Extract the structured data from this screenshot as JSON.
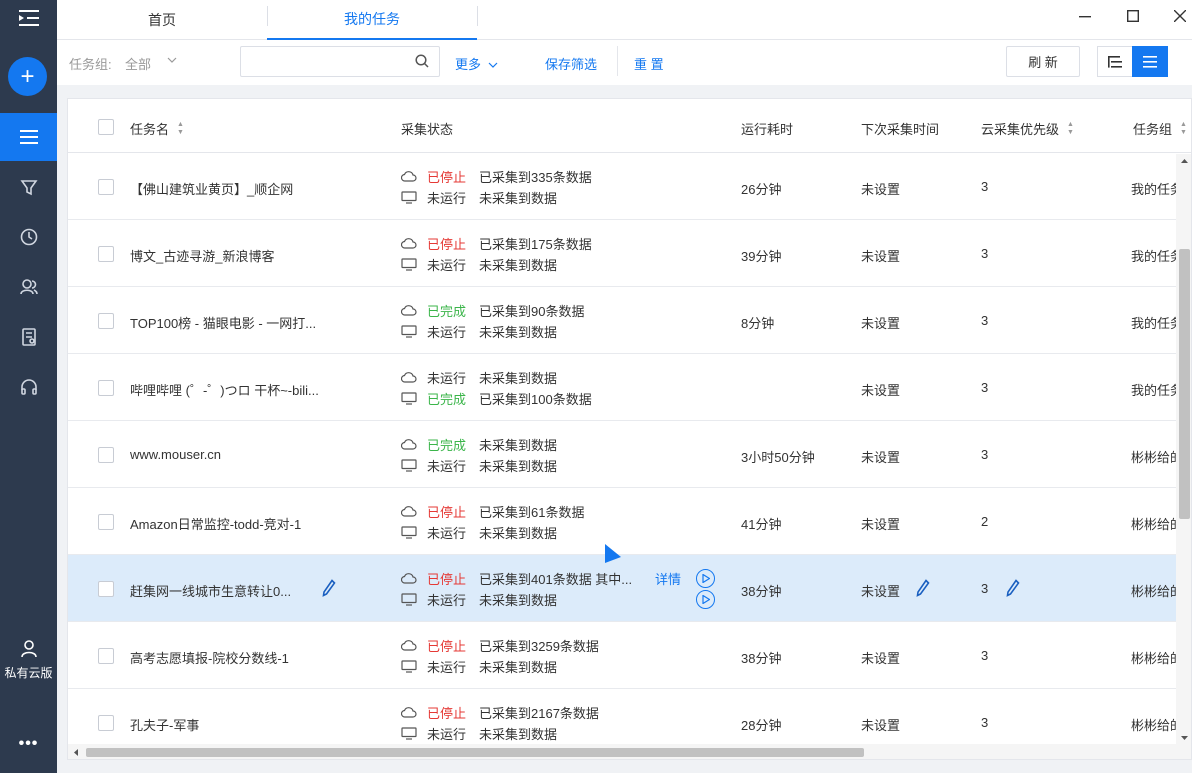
{
  "tabs": [
    {
      "label": "首页",
      "active": false
    },
    {
      "label": "我的任务",
      "active": true
    }
  ],
  "sidebar": {
    "private_cloud_label": "私有云版",
    "more_label": "•••",
    "accent": "#1478f0",
    "bg": "#2d3a4e"
  },
  "filter": {
    "group_label": "任务组:",
    "group_value": "全部",
    "search_placeholder": "",
    "more_label": "更多",
    "save_filter_label": "保存筛选",
    "reset_label": "重 置",
    "refresh_label": "刷 新"
  },
  "table": {
    "columns": [
      "任务名",
      "采集状态",
      "运行耗时",
      "下次采集时间",
      "云采集优先级",
      "任务组"
    ],
    "detail_label": "详情",
    "rows": [
      {
        "name": "【佛山建筑业黄页】_顺企网",
        "cloud_state": "已停止",
        "cloud_state_color": "red",
        "cloud_desc": "已采集到335条数据",
        "local_state": "未运行",
        "local_state_color": "gray",
        "local_desc": "未采集到数据",
        "duration": "26分钟",
        "next_time": "未设置",
        "priority": "3",
        "group": "我的任务"
      },
      {
        "name": "博文_古迹寻游_新浪博客",
        "cloud_state": "已停止",
        "cloud_state_color": "red",
        "cloud_desc": "已采集到175条数据",
        "local_state": "未运行",
        "local_state_color": "gray",
        "local_desc": "未采集到数据",
        "duration": "39分钟",
        "next_time": "未设置",
        "priority": "3",
        "group": "我的任务"
      },
      {
        "name": "TOP100榜 - 猫眼电影 - 一网打...",
        "cloud_state": "已完成",
        "cloud_state_color": "green",
        "cloud_desc": "已采集到90条数据",
        "local_state": "未运行",
        "local_state_color": "gray",
        "local_desc": "未采集到数据",
        "duration": "8分钟",
        "next_time": "未设置",
        "priority": "3",
        "group": "我的任务"
      },
      {
        "name": "哔哩哔哩 (゜-゜)つロ 干杯~-bili...",
        "cloud_state": "未运行",
        "cloud_state_color": "gray",
        "cloud_desc": "未采集到数据",
        "local_state": "已完成",
        "local_state_color": "green",
        "local_desc": "已采集到100条数据",
        "duration": "",
        "next_time": "未设置",
        "priority": "3",
        "group": "我的任务"
      },
      {
        "name": "www.mouser.cn",
        "cloud_state": "已完成",
        "cloud_state_color": "green",
        "cloud_desc": "未采集到数据",
        "local_state": "未运行",
        "local_state_color": "gray",
        "local_desc": "未采集到数据",
        "duration": "3小时50分钟",
        "next_time": "未设置",
        "priority": "3",
        "group": "彬彬给的"
      },
      {
        "name": "Amazon日常监控-todd-竞对-1",
        "cloud_state": "已停止",
        "cloud_state_color": "red",
        "cloud_desc": "已采集到61条数据",
        "local_state": "未运行",
        "local_state_color": "gray",
        "local_desc": "未采集到数据",
        "duration": "41分钟",
        "next_time": "未设置",
        "priority": "2",
        "group": "彬彬给的"
      },
      {
        "name": "赶集网一线城市生意转让0...",
        "cloud_state": "已停止",
        "cloud_state_color": "red",
        "cloud_desc": "已采集到401条数据 其中...",
        "local_state": "未运行",
        "local_state_color": "gray",
        "local_desc": "未采集到数据",
        "duration": "38分钟",
        "next_time": "未设置",
        "priority": "3",
        "group": "彬彬给的",
        "selected": true
      },
      {
        "name": "高考志愿填报-院校分数线-1",
        "cloud_state": "已停止",
        "cloud_state_color": "red",
        "cloud_desc": "已采集到3259条数据",
        "local_state": "未运行",
        "local_state_color": "gray",
        "local_desc": "未采集到数据",
        "duration": "38分钟",
        "next_time": "未设置",
        "priority": "3",
        "group": "彬彬给的"
      },
      {
        "name": "孔夫子-军事",
        "cloud_state": "已停止",
        "cloud_state_color": "red",
        "cloud_desc": "已采集到2167条数据",
        "local_state": "未运行",
        "local_state_color": "gray",
        "local_desc": "未采集到数据",
        "duration": "28分钟",
        "next_time": "未设置",
        "priority": "3",
        "group": "彬彬给的"
      }
    ]
  }
}
